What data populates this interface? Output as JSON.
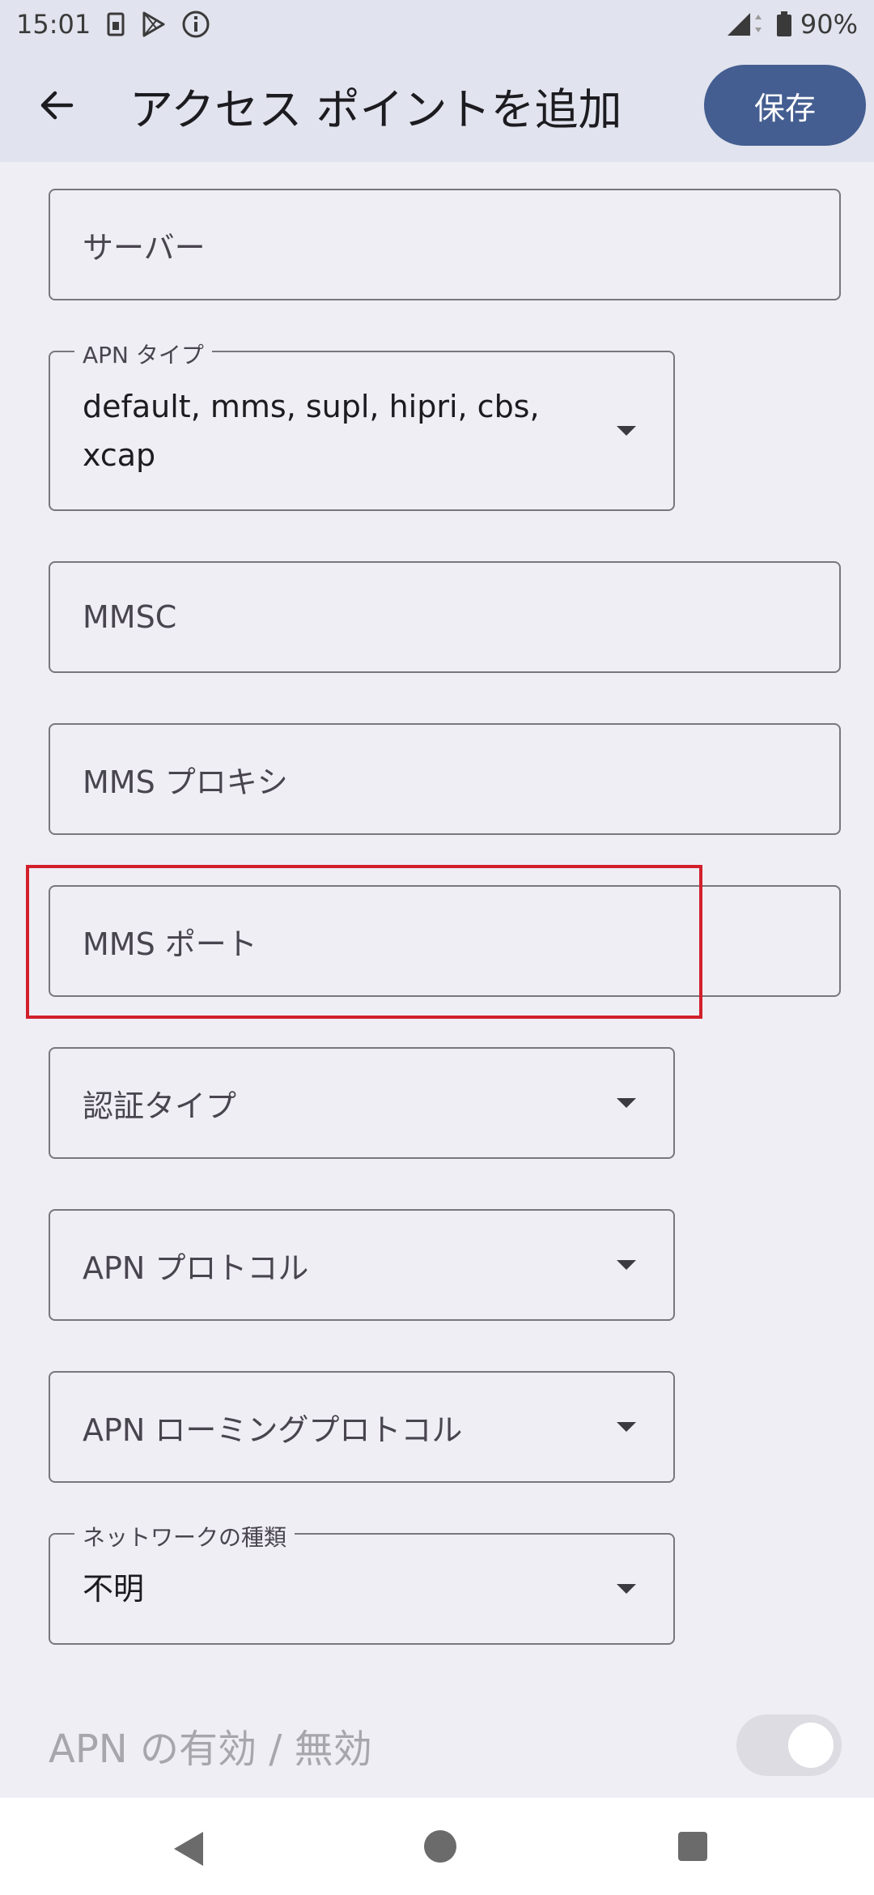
{
  "status_bar": {
    "time": "15:01",
    "battery": "90%",
    "icons": [
      "sim-card-icon",
      "play-store-icon",
      "info-icon",
      "signal-icon",
      "battery-icon"
    ]
  },
  "app_bar": {
    "back_icon": "arrow-left-icon",
    "title": "アクセス ポイントを追加",
    "save_label": "保存"
  },
  "fields": {
    "server": {
      "placeholder": "サーバー"
    },
    "apn_type": {
      "label": "APN タイプ",
      "value": "default, mms, supl, hipri, cbs, xcap"
    },
    "mmsc": {
      "placeholder": "MMSC"
    },
    "mms_proxy": {
      "placeholder": "MMS プロキシ"
    },
    "mms_port": {
      "placeholder": "MMS ポート"
    },
    "auth_type": {
      "placeholder": "認証タイプ"
    },
    "apn_protocol": {
      "placeholder": "APN プロトコル"
    },
    "apn_roaming_protocol": {
      "placeholder": "APN ローミングプロトコル"
    },
    "network_type": {
      "label": "ネットワークの種類",
      "value": "不明"
    }
  },
  "apn_toggle": {
    "label": "APN の有効 / 無効",
    "enabled": false
  },
  "colors": {
    "accent": "#445e91",
    "highlight": "#d2202b"
  }
}
